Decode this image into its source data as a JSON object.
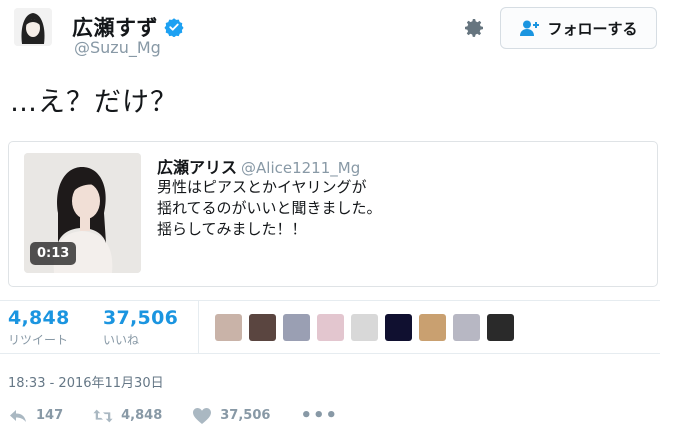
{
  "author": {
    "name": "広瀬すず",
    "handle": "@Suzu_Mg"
  },
  "header": {
    "follow_label": "フォローする"
  },
  "tweet": {
    "text": "…え？だけ？"
  },
  "quoted": {
    "name": "広瀬アリス",
    "handle": "@Alice1211_Mg",
    "text": "男性はピアスとかイヤリングが\n揺れてるのがいいと聞きました。\n揺らしてみました！！",
    "video_duration": "0:13"
  },
  "stats": {
    "retweets_count": "4,848",
    "retweets_label": "リツイート",
    "likes_count": "37,506",
    "likes_label": "いいね"
  },
  "likers": [
    {
      "color": "#c9b3a8"
    },
    {
      "color": "#5a4540"
    },
    {
      "color": "#9a9fb3"
    },
    {
      "color": "#e3c6cf"
    },
    {
      "color": "#d8d8d8"
    },
    {
      "color": "#101030"
    },
    {
      "color": "#c9a070"
    },
    {
      "color": "#b7b7c3"
    },
    {
      "color": "#2a2a2a"
    }
  ],
  "timestamp": "18:33 - 2016年11月30日",
  "actions": {
    "reply_count": "147",
    "retweet_count": "4,848",
    "like_count": "37,506",
    "more": "•••"
  },
  "colors": {
    "accent": "#1b95e0",
    "verified": "#1da1f2",
    "muted": "#8899a6"
  },
  "icons": [
    "verified-icon",
    "gear-icon",
    "follow-user-icon",
    "reply-icon",
    "retweet-icon",
    "heart-icon",
    "more-icon"
  ]
}
